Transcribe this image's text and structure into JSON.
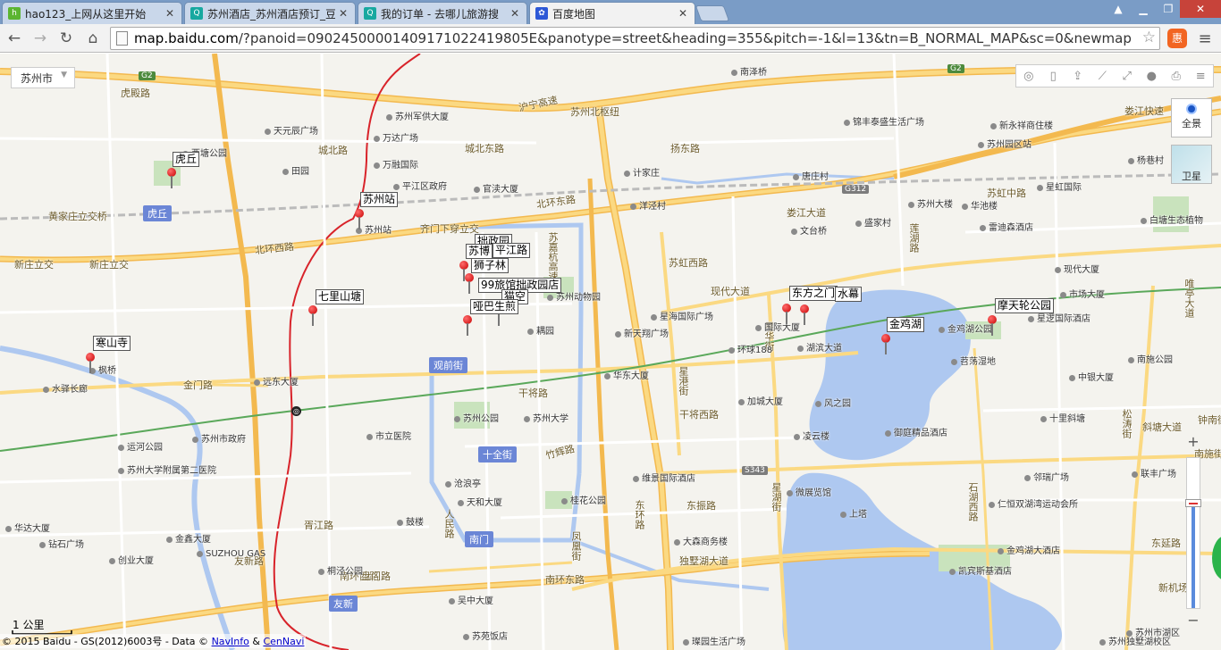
{
  "browser": {
    "tabs": [
      {
        "title": "hao123_上网从这里开始",
        "icon": "hao123-icon"
      },
      {
        "title": "苏州酒店_苏州酒店预订_豆",
        "icon": "qunar-icon"
      },
      {
        "title": "我的订单 - 去哪儿旅游搜",
        "icon": "qunar-icon"
      },
      {
        "title": "百度地图",
        "icon": "baidu-paw-icon"
      }
    ],
    "url_lead": "map.baidu.com",
    "url_rest": "/?panoid=09024500001409171022419805E&panotype=street&heading=355&pitch=-1&l=13&tn=B_NORMAL_MAP&sc=0&newmap"
  },
  "map": {
    "city_select": "苏州市",
    "panorama_label": "全景",
    "satellite_label": "卫星",
    "zoom_in": "+",
    "zoom_out": "−",
    "scale_label": "1 公里",
    "copyright_prefix": "© 2015 Baidu - GS(2012)6003号 - Data ©",
    "copyright_navinfo": "NavInfo",
    "copyright_and": "&",
    "copyright_cennavi": "CenNavi",
    "markers": [
      {
        "label": "虎丘"
      },
      {
        "label": "苏州站"
      },
      {
        "label": "拙政园"
      },
      {
        "label": "苏博"
      },
      {
        "label": "平江路"
      },
      {
        "label": "狮子林"
      },
      {
        "label": "99旅馆拙政园店"
      },
      {
        "label": "猫空"
      },
      {
        "label": "哑巴生煎"
      },
      {
        "label": "七里山塘"
      },
      {
        "label": "寒山寺"
      },
      {
        "label": "东方之门"
      },
      {
        "label": "水幕"
      },
      {
        "label": "金鸡湖"
      },
      {
        "label": "摩天轮公园"
      }
    ],
    "districts": [
      "虎丘",
      "观前街",
      "十全街",
      "南门",
      "友新"
    ],
    "highways": [
      "G2",
      "G2",
      "G312",
      "S343"
    ],
    "roads": [
      "虎殿路",
      "沪宁高速",
      "苏州北枢纽",
      "城北路",
      "城北东路",
      "北环东路",
      "北环西路",
      "黄家庄立交桥",
      "新庄立交",
      "齐门下穿立交",
      "金门路",
      "干将西路",
      "干将路",
      "南环东路",
      "南环西路",
      "独墅湖大道",
      "现代大道",
      "苏虹西路",
      "苏虹中路",
      "娄江快速",
      "扬东路",
      "娄江大道",
      "星港街",
      "东环路",
      "盘门路",
      "东振路",
      "竹辉路",
      "胥江路",
      "人民路",
      "苏嘉杭高速",
      "新庄立交",
      "友新路",
      "凤凰街",
      "莲湖路",
      "石湖西路",
      "星华街",
      "斜塘大道",
      "东延路",
      "新机场路",
      "星湖街",
      "松涛街",
      "唯亭大道",
      "钟南街",
      "南施街"
    ],
    "pois": [
      "苏州军供大厦",
      "天元辰广场",
      "万达广场",
      "万融国际",
      "平江区政府",
      "官渎大厦",
      "田园",
      "西塘公园",
      "苏州站",
      "苏州动物园",
      "耦园",
      "国际大厦",
      "湖滨大道",
      "环球188",
      "新天翔广场",
      "星海国际广场",
      "苏州公园",
      "苏州大学",
      "市立医院",
      "沧浪亭",
      "天和大厦",
      "桂花公园",
      "鼓楼",
      "苏州市政府",
      "运河公园",
      "苏州大学附属第二医院",
      "华达大厦",
      "钻石广场",
      "创业大厦",
      "金鑫大厦",
      "SUZHOU GAS",
      "桐泾公园",
      "吴中大厦",
      "苏苑饭店",
      "璨园生活广场",
      "大森商务楼",
      "微展览馆",
      "维景国际酒店",
      "凌云楼",
      "御庭精品酒店",
      "风之园",
      "加城大厦",
      "华东大厦",
      "远东大厦",
      "枫桥",
      "水驿长廊",
      "锦丰泰盛生活广场",
      "苏州园区站",
      "新永祥商住楼",
      "现代大厦",
      "市场大厦",
      "雷迪森酒店",
      "星虹国际",
      "华池楼",
      "白塘生态植物",
      "金鸡湖公园",
      "星逻国际酒店",
      "苕荡湿地",
      "中银大厦",
      "十里斜塘",
      "邻瑞广场",
      "仁恒双湖湾运动会所",
      "金鸡湖大酒店",
      "凯宾斯基酒店",
      "苏州独墅湖校区",
      "联丰广场",
      "南施公园",
      "上塔",
      "文台桥",
      "盛家村",
      "苏州大楼",
      "杨巷村",
      "计家庄",
      "唐庄村",
      "洋泾村",
      "南泽桥",
      "苏州市湖区"
    ]
  }
}
